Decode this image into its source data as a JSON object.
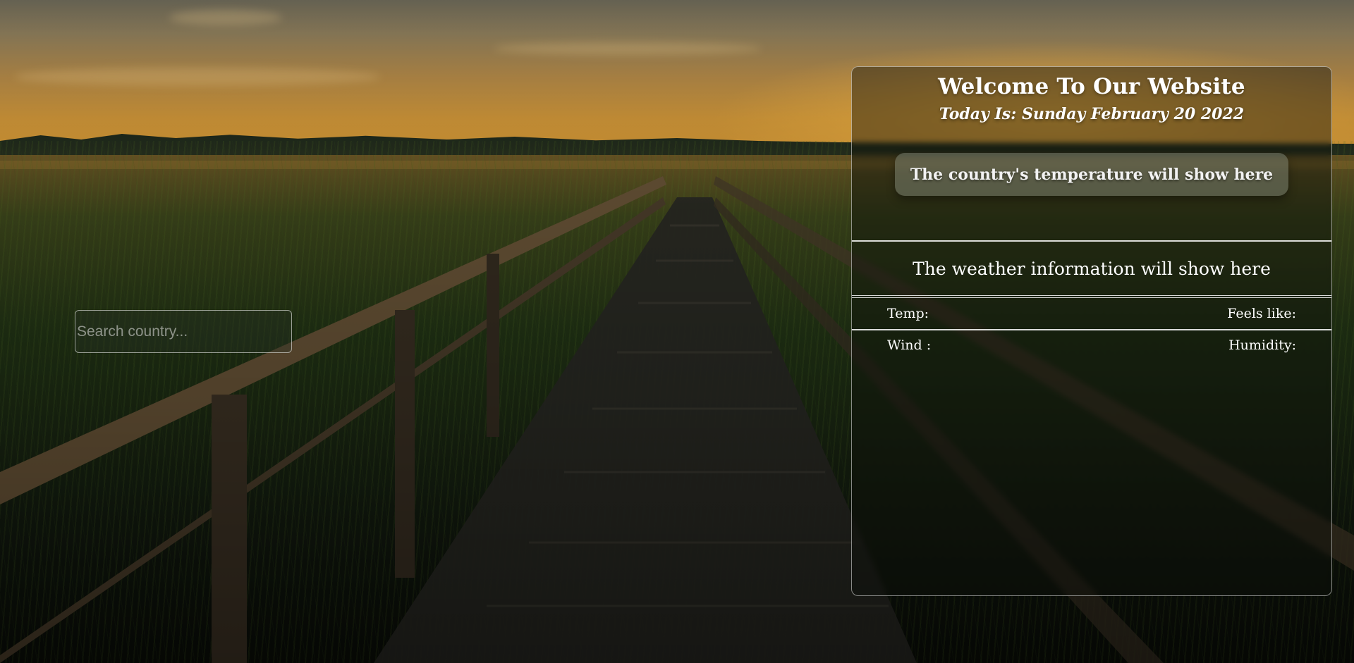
{
  "search": {
    "placeholder": "Search country..."
  },
  "card": {
    "title": "Welcome To Our Website",
    "date_prefix": "Today Is: ",
    "date_value": "Sunday February 20 2022",
    "temperature_placeholder": "The country's temperature will show here",
    "weather_placeholder": "The weather information will show here",
    "stats": {
      "temp_label": "Temp:",
      "feels_like_label": "Feels like:",
      "wind_label": "Wind :",
      "humidity_label": "Humidity:"
    }
  },
  "colors": {
    "card_border": "#ffffff",
    "text": "#ffffff",
    "sky_glow": "#e3a238"
  }
}
